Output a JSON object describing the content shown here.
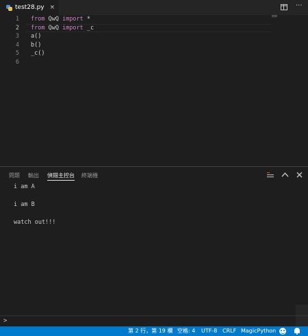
{
  "tabs": [
    {
      "label": "test28.py",
      "close": "×"
    }
  ],
  "editor": {
    "lines": [
      {
        "num": "1",
        "tokens": [
          {
            "t": "from",
            "k": "kw"
          },
          {
            "t": " QwQ ",
            "k": "mod"
          },
          {
            "t": "import",
            "k": "kw"
          },
          {
            "t": " *",
            "k": "mod"
          }
        ]
      },
      {
        "num": "2",
        "tokens": [
          {
            "t": "from",
            "k": "kw"
          },
          {
            "t": " QwQ ",
            "k": "mod"
          },
          {
            "t": "import",
            "k": "kw"
          },
          {
            "t": " _c",
            "k": "mod"
          }
        ]
      },
      {
        "num": "3",
        "tokens": [
          {
            "t": "a()",
            "k": "mod"
          }
        ]
      },
      {
        "num": "4",
        "tokens": [
          {
            "t": "b()",
            "k": "mod"
          }
        ]
      },
      {
        "num": "5",
        "tokens": [
          {
            "t": "_c()",
            "k": "mod"
          }
        ]
      },
      {
        "num": "6",
        "tokens": []
      }
    ],
    "active_line": "2"
  },
  "panel": {
    "tabs": [
      "問題",
      "輸出",
      "偵錯主控台",
      "終端機"
    ],
    "active_tab": "偵錯主控台",
    "output": [
      "i am A",
      "i am B",
      "watch out!!!"
    ],
    "prompt": ">"
  },
  "statusbar": {
    "position": "第 2 行，第 19 欄",
    "spaces": "空格: 4",
    "encoding": "UTF-8",
    "eol": "CRLF",
    "language": "MagicPython"
  },
  "colors": {
    "statusbar": "#007acc",
    "keyword": "#c586c0",
    "editor_bg": "#1e1e1e"
  },
  "icons": [
    "python-file-icon",
    "split-editor-icon",
    "more-actions-icon",
    "clear-console-icon",
    "maximize-panel-icon",
    "close-panel-icon",
    "feedback-smiley-icon",
    "notification-bell-icon"
  ]
}
